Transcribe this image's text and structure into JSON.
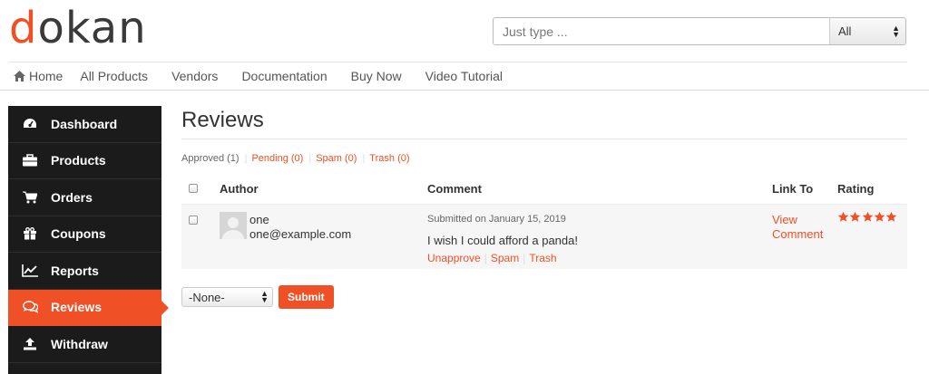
{
  "brand": {
    "logo_first": "d",
    "logo_rest": "okan",
    "accent": "#f05025"
  },
  "search": {
    "placeholder": "Just type ...",
    "category": "All"
  },
  "nav": [
    {
      "label": "Home",
      "icon": "home-icon"
    },
    {
      "label": "All Products"
    },
    {
      "label": "Vendors"
    },
    {
      "label": "Documentation"
    },
    {
      "label": "Buy Now"
    },
    {
      "label": "Video Tutorial"
    }
  ],
  "sidebar": [
    {
      "label": "Dashboard",
      "icon": "dashboard-icon"
    },
    {
      "label": "Products",
      "icon": "briefcase-icon"
    },
    {
      "label": "Orders",
      "icon": "cart-icon"
    },
    {
      "label": "Coupons",
      "icon": "gift-icon"
    },
    {
      "label": "Reports",
      "icon": "chart-icon"
    },
    {
      "label": "Reviews",
      "icon": "comments-icon",
      "active": true
    },
    {
      "label": "Withdraw",
      "icon": "upload-icon"
    }
  ],
  "page": {
    "title": "Reviews"
  },
  "filters": [
    {
      "label": "Approved (1)",
      "current": true
    },
    {
      "label": "Pending (0)"
    },
    {
      "label": "Spam (0)"
    },
    {
      "label": "Trash (0)"
    }
  ],
  "table": {
    "headers": {
      "author": "Author",
      "comment": "Comment",
      "link": "Link To",
      "rating": "Rating"
    },
    "rows": [
      {
        "author_name": "one",
        "author_email": "one@example.com",
        "submitted": "Submitted on January 15, 2019",
        "comment": "I wish I could afford a panda!",
        "actions": [
          "Unapprove",
          "Spam",
          "Trash"
        ],
        "link_line1": "View",
        "link_line2": "Comment",
        "rating": 5
      }
    ]
  },
  "bulk": {
    "selected": "-None-",
    "submit_label": "Submit"
  }
}
